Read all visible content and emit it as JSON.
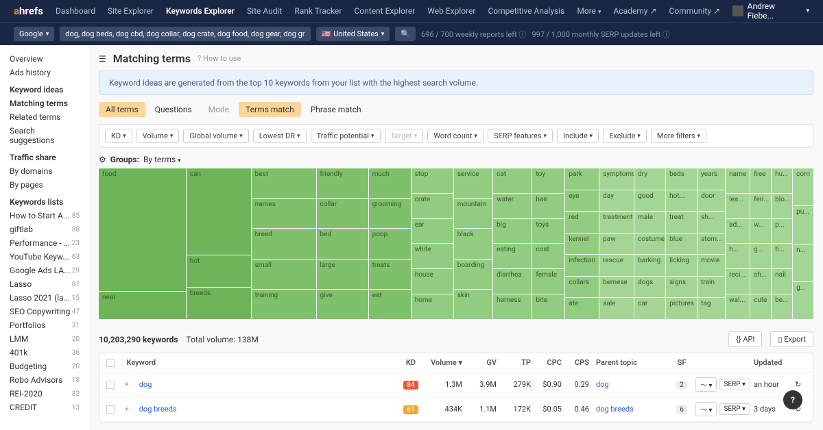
{
  "logo": {
    "a": "a",
    "rest": "hrefs"
  },
  "nav": [
    "Dashboard",
    "Site Explorer",
    "Keywords Explorer",
    "Site Audit",
    "Rank Tracker",
    "Content Explorer",
    "Web Explorer",
    "Competitive Analysis",
    "More"
  ],
  "nav_active": 2,
  "nav_right": {
    "academy": "Academy",
    "community": "Community",
    "user": "Andrew Fiebe..."
  },
  "subbar": {
    "engine": "Google",
    "keywords": "dog, dog beds, dog cbd, dog collar, dog crate, dog food, dog gear, dog gr",
    "country": "United States",
    "quota1": "696 / 700 weekly reports left",
    "quota2": "997 / 1,000 monthly SERP updates left"
  },
  "sidebar": {
    "top": [
      "Overview",
      "Ads history"
    ],
    "ideas_head": "Keyword ideas",
    "ideas": [
      "Matching terms",
      "Related terms",
      "Search suggestions"
    ],
    "traffic_head": "Traffic share",
    "traffic": [
      "By domains",
      "By pages"
    ],
    "lists_head": "Keywords lists",
    "lists": [
      {
        "n": "How to Start A...",
        "c": "85"
      },
      {
        "n": "giftlab",
        "c": "88"
      },
      {
        "n": "Performance - ...",
        "c": "23"
      },
      {
        "n": "YouTube Keyw...",
        "c": "63"
      },
      {
        "n": "Google Ads LA...",
        "c": "29"
      },
      {
        "n": "Lasso",
        "c": "87"
      },
      {
        "n": "Lasso 2021 (la...",
        "c": "15"
      },
      {
        "n": "SEO Copywriting",
        "c": "47"
      },
      {
        "n": "Portfolios",
        "c": "31"
      },
      {
        "n": "LMM",
        "c": "20"
      },
      {
        "n": "401k",
        "c": "36"
      },
      {
        "n": "Budgeting",
        "c": "20"
      },
      {
        "n": "Robo Advisors",
        "c": "18"
      },
      {
        "n": "REI-2020",
        "c": "82"
      },
      {
        "n": "CREDIT",
        "c": "13"
      }
    ]
  },
  "page": {
    "title": "Matching terms",
    "howto": "How to use",
    "banner": "Keyword ideas are generated from the top 10 keywords from your list with the highest search volume."
  },
  "tabs": {
    "all": "All terms",
    "q": "Questions",
    "mode": "Mode",
    "tm": "Terms match",
    "pm": "Phrase match"
  },
  "filters": [
    "KD",
    "Volume",
    "Global volume",
    "Lowest DR",
    "Traffic potential",
    "Target",
    "Word count",
    "SERP features",
    "Include",
    "Exclude",
    "More filters"
  ],
  "groups": {
    "label": "Groups:",
    "by": "By terms"
  },
  "results": {
    "count": "10,203,290 keywords",
    "totalvol": "Total volume: 138M",
    "api": "API",
    "export": "Export"
  },
  "thead": {
    "kw": "Keyword",
    "kd": "KD",
    "vol": "Volume",
    "gv": "GV",
    "tp": "TP",
    "cpc": "CPC",
    "cps": "CPS",
    "pt": "Parent topic",
    "sf": "SF",
    "upd": "Updated"
  },
  "rows": [
    {
      "kw": "dog",
      "kd": "84",
      "kdc": "kd-84",
      "vol": "1.3M",
      "gv": "3.9M",
      "tp": "279K",
      "cpc": "$0.90",
      "cps": "0.29",
      "pt": "dog",
      "sf": "2",
      "upd": "an hour"
    },
    {
      "kw": "dog breeds",
      "kd": "61",
      "kdc": "kd-61",
      "vol": "434K",
      "gv": "1.1M",
      "tp": "172K",
      "cpc": "$0.05",
      "cps": "0.46",
      "pt": "dog breeds",
      "sf": "6",
      "upd": "3 days"
    }
  ],
  "serp_label": "SERP",
  "treemap": {
    "c1": [
      "food",
      "near"
    ],
    "c2": [
      "can",
      "hot",
      "breeds"
    ],
    "c3": [
      "best",
      "names",
      "breed",
      "small",
      "training"
    ],
    "c4": [
      "friendly",
      "collar",
      "bed",
      "large",
      "give"
    ],
    "c5": [
      "much",
      "grooming",
      "poop",
      "treats",
      "eat"
    ],
    "c6": [
      "stop",
      "crate",
      "ear",
      "white",
      "house",
      "home"
    ],
    "c7": [
      "service",
      "mountain",
      "black",
      "boarding",
      "skin"
    ],
    "c8": [
      "cat",
      "water",
      "big",
      "eating",
      "diarrhea",
      "harness"
    ],
    "c9": [
      "toy",
      "hair",
      "toys",
      "cost",
      "female",
      "bite"
    ],
    "c10": [
      "park",
      "eye",
      "red",
      "kennel",
      "infection",
      "collars",
      "ate"
    ],
    "c11": [
      "symptoms",
      "day",
      "treatment",
      "paw",
      "rescue",
      "bernese",
      "sale"
    ],
    "c12": [
      "dry",
      "good",
      "male",
      "costume",
      "barking",
      "dogs",
      "car"
    ],
    "c13": [
      "beds",
      "hot...",
      "treat",
      "blue",
      "licking",
      "signs",
      "pictures"
    ],
    "c14": [
      "years",
      "door",
      "sh...",
      "stom...",
      "movie",
      "train",
      "tag"
    ],
    "c15": [
      "name",
      "lea...",
      "ad...",
      "h...",
      "reci...",
      "wal..."
    ],
    "c16": [
      "free",
      "fen...",
      "w...",
      "g...",
      "sh...",
      "cute"
    ],
    "c17": [
      "hu...",
      "blo...",
      "p...",
      "ti...",
      "nail",
      "be..."
    ],
    "c18": [
      "corn",
      "pu...",
      "n...",
      "g..."
    ]
  }
}
